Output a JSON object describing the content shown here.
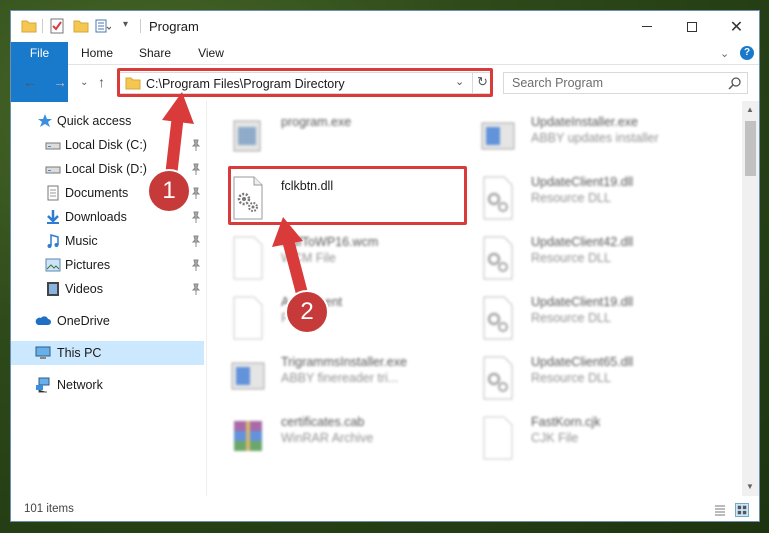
{
  "window": {
    "title": "Program"
  },
  "ribbon": {
    "tabs": [
      "File",
      "Home",
      "Share",
      "View"
    ]
  },
  "address_bar": {
    "path": "C:\\Program Files\\Program Directory"
  },
  "search": {
    "placeholder": "Search Program"
  },
  "sidebar": {
    "items": [
      {
        "label": "Quick access",
        "icon": "star-icon",
        "pinned": false
      },
      {
        "label": "Local Disk (C:)",
        "icon": "drive-icon",
        "pinned": true
      },
      {
        "label": "Local Disk (D:)",
        "icon": "drive-icon",
        "pinned": true
      },
      {
        "label": "Documents",
        "icon": "documents-icon",
        "pinned": true
      },
      {
        "label": "Downloads",
        "icon": "download-icon",
        "pinned": true
      },
      {
        "label": "Music",
        "icon": "music-icon",
        "pinned": true
      },
      {
        "label": "Pictures",
        "icon": "pictures-icon",
        "pinned": true
      },
      {
        "label": "Videos",
        "icon": "videos-icon",
        "pinned": true
      },
      {
        "label": "OneDrive",
        "icon": "cloud-icon",
        "pinned": false
      },
      {
        "label": "This PC",
        "icon": "computer-icon",
        "pinned": false,
        "selected": true
      },
      {
        "label": "Network",
        "icon": "network-icon",
        "pinned": false
      }
    ]
  },
  "files": {
    "left": [
      {
        "name": "program.exe",
        "type": ""
      },
      {
        "name": "fclkbtn.dll",
        "type": ""
      },
      {
        "name": "MdfToWP16.wcm",
        "type": "WCM File"
      },
      {
        "name": "Agreement",
        "type": "File"
      },
      {
        "name": "TrigrammsInstaller.exe",
        "type": "ABBY finereader tri..."
      },
      {
        "name": "certificates.cab",
        "type": "WinRAR Archive"
      }
    ],
    "right": [
      {
        "name": "UpdateInstaller.exe",
        "type": "ABBY updates installer"
      },
      {
        "name": "UpdateClient19.dll",
        "type": "Resource DLL"
      },
      {
        "name": "UpdateClient42.dll",
        "type": "Resource DLL"
      },
      {
        "name": "UpdateClient19.dll",
        "type": "Resource DLL"
      },
      {
        "name": "UpdateClient65.dll",
        "type": "Resource DLL"
      },
      {
        "name": "FastKorn.cjk",
        "type": "CJK File"
      }
    ]
  },
  "status": {
    "item_count": "101 items"
  },
  "annotations": {
    "marker1": "1",
    "marker2": "2"
  },
  "colors": {
    "accent": "#1979ca",
    "highlight": "#d93b3b",
    "marker": "#c73a3a",
    "selection": "#cce8ff"
  }
}
